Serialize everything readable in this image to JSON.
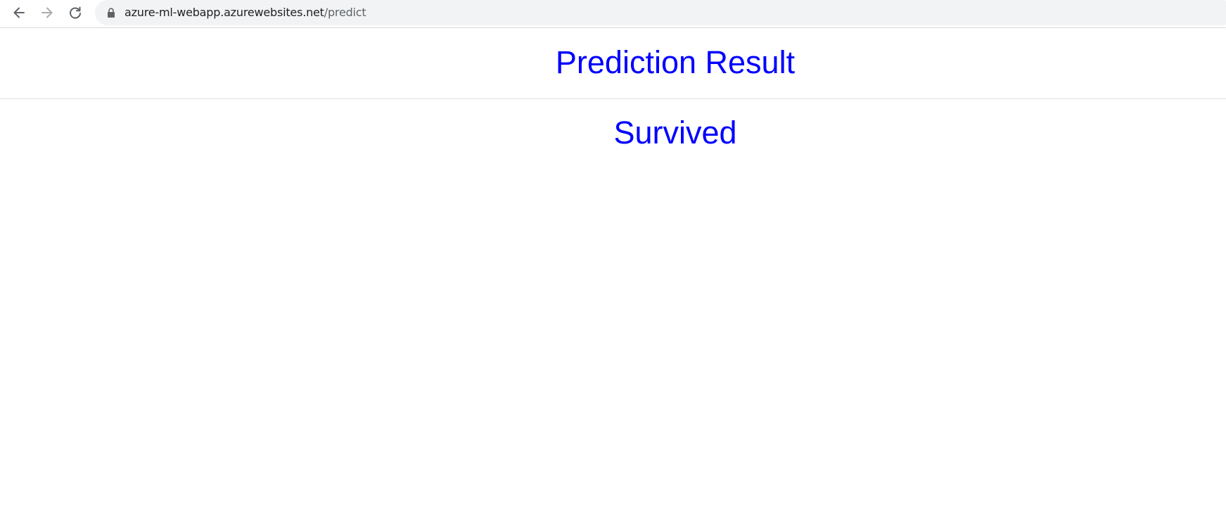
{
  "browser": {
    "url_host": "azure-ml-webapp.azurewebsites.net",
    "url_path": "/predict",
    "icons": [
      "back-arrow-icon",
      "forward-arrow-icon",
      "reload-icon",
      "lock-icon"
    ]
  },
  "page": {
    "title": "Prediction Result",
    "result": "Survived"
  },
  "colors": {
    "heading": "#0000ff",
    "omnibox_bg": "#f1f3f4",
    "url_host": "#202124",
    "url_path": "#5f6368"
  }
}
